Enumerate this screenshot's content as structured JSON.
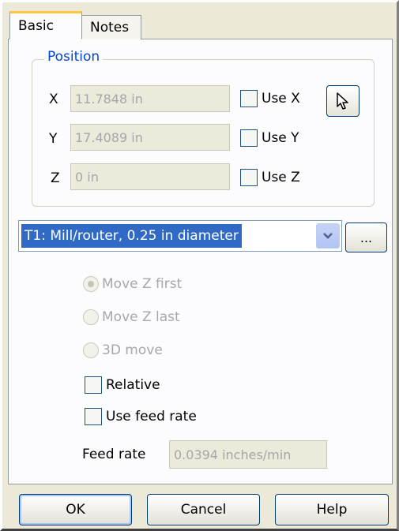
{
  "tabs": [
    {
      "label": "Basic",
      "active": true
    },
    {
      "label": "Notes",
      "active": false
    }
  ],
  "position": {
    "title": "Position",
    "rows": [
      {
        "axis": "X",
        "value": "11.7848 in",
        "use_label": "Use X",
        "checked": false
      },
      {
        "axis": "Y",
        "value": "17.4089 in",
        "use_label": "Use Y",
        "checked": false
      },
      {
        "axis": "Z",
        "value": "0 in",
        "use_label": "Use Z",
        "checked": false
      }
    ],
    "pick_icon": "arrow-cursor-icon"
  },
  "tool": {
    "selected": "T1: Mill/router, 0.25 in diameter",
    "dropdown_icon": "chevron-down-icon",
    "browse_label": "..."
  },
  "move_options": [
    {
      "label": "Move Z first",
      "selected": true,
      "enabled": false
    },
    {
      "label": "Move Z last",
      "selected": false,
      "enabled": false
    },
    {
      "label": "3D move",
      "selected": false,
      "enabled": false
    }
  ],
  "relative": {
    "label": "Relative",
    "checked": false
  },
  "use_feed_rate": {
    "label": "Use feed rate",
    "checked": false
  },
  "feed_rate": {
    "label": "Feed rate",
    "value": "0.0394 inches/min"
  },
  "buttons": {
    "ok": "OK",
    "cancel": "Cancel",
    "help": "Help"
  },
  "colors": {
    "accent": "#0046d5",
    "selection": "#316ac5",
    "tab_highlight": "#ffc83c"
  }
}
